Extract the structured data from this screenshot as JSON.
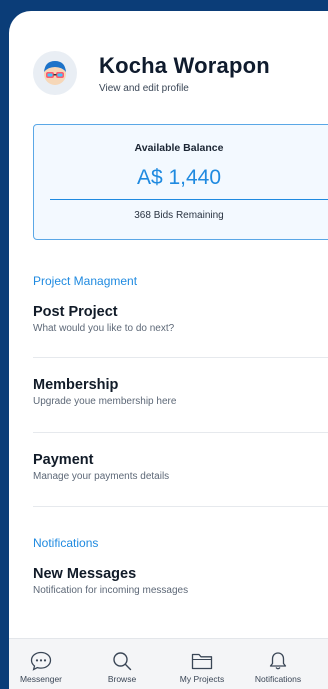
{
  "profile": {
    "name": "Kocha Worapon",
    "subtitle": "View and edit profile",
    "avatar_icon": "avatar-glasses-icon"
  },
  "balance": {
    "label": "Available Balance",
    "amount": "A$ 1,440",
    "bids": "368 Bids Remaining"
  },
  "project_section": {
    "title": "Project Managment",
    "items": [
      {
        "title": "Post Project",
        "desc": "What would you like to do next?"
      },
      {
        "title": "Membership",
        "desc": "Upgrade youe membership here"
      },
      {
        "title": "Payment",
        "desc": "Manage your payments details"
      }
    ]
  },
  "notifications_section": {
    "title": "Notifications",
    "items": [
      {
        "title": "New Messages",
        "desc": "Notification for incoming messages"
      }
    ]
  },
  "tabs": [
    {
      "label": "Messenger",
      "icon": "chat-bubble-icon"
    },
    {
      "label": "Browse",
      "icon": "search-icon"
    },
    {
      "label": "My Projects",
      "icon": "folder-icon"
    },
    {
      "label": "Notifications",
      "icon": "bell-icon"
    }
  ],
  "colors": {
    "background": "#0b3d78",
    "accent": "#1f8ae0"
  }
}
